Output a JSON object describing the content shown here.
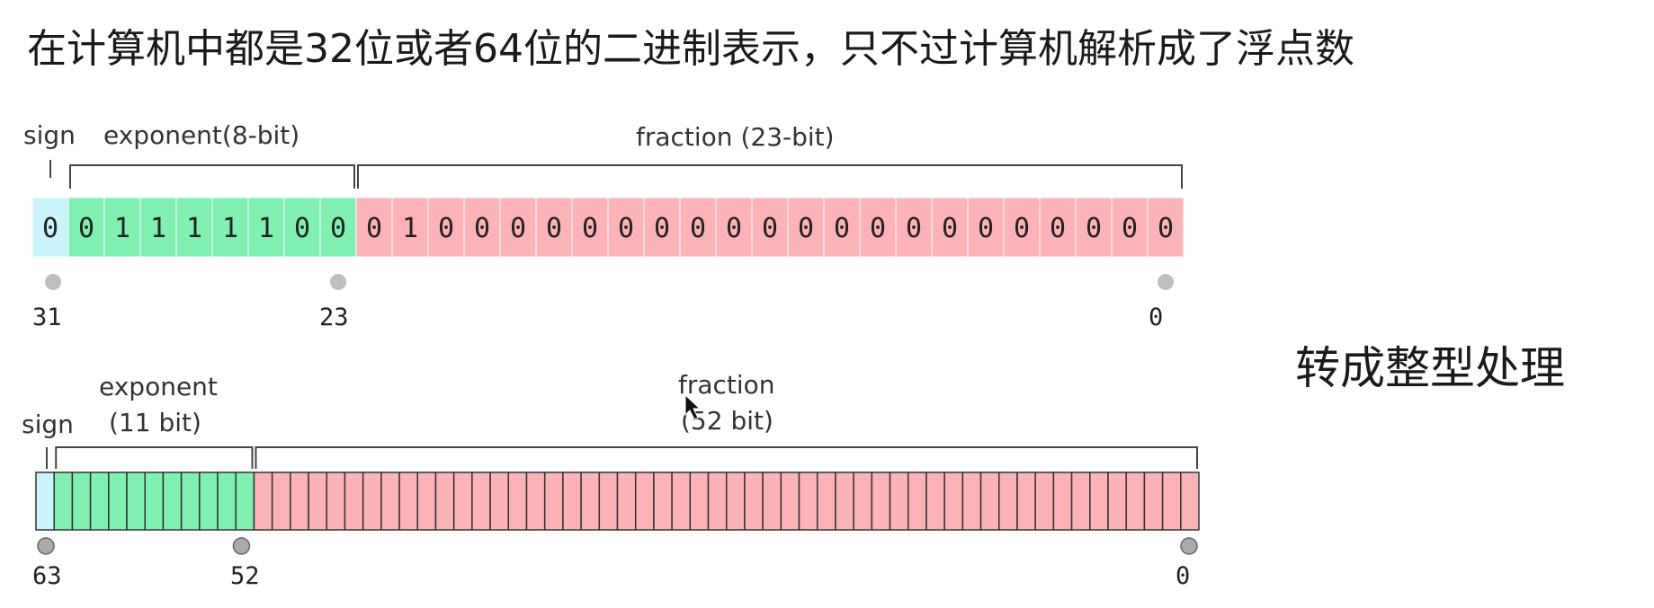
{
  "title": "在计算机中都是32位或者64位的二进制表示，只不过计算机解析成了浮点数",
  "note": "转成整型处理",
  "single": {
    "sign_label": "sign",
    "exponent_label": "exponent(8-bit)",
    "fraction_label": "fraction (23-bit)",
    "bits": "00111110001000000000000000000000",
    "positions": [
      "31",
      "23",
      "0"
    ]
  },
  "double": {
    "sign_label": "sign",
    "exponent_label_line1": "exponent",
    "exponent_label_line2": "(11 bit)",
    "fraction_label_line1": "fraction",
    "fraction_label_line2": "(52 bit)",
    "total_bits": 64,
    "exponent_bits": 11,
    "positions": [
      "63",
      "52",
      "0"
    ]
  },
  "colors": {
    "sign": "#c9f4fb",
    "exponent": "#7ff0b0",
    "fraction": "#fbb3b8",
    "cell_border": "#ffffff",
    "cell_border_double": "#333333",
    "bracket": "#444444",
    "dot": "#bfbfbf"
  }
}
